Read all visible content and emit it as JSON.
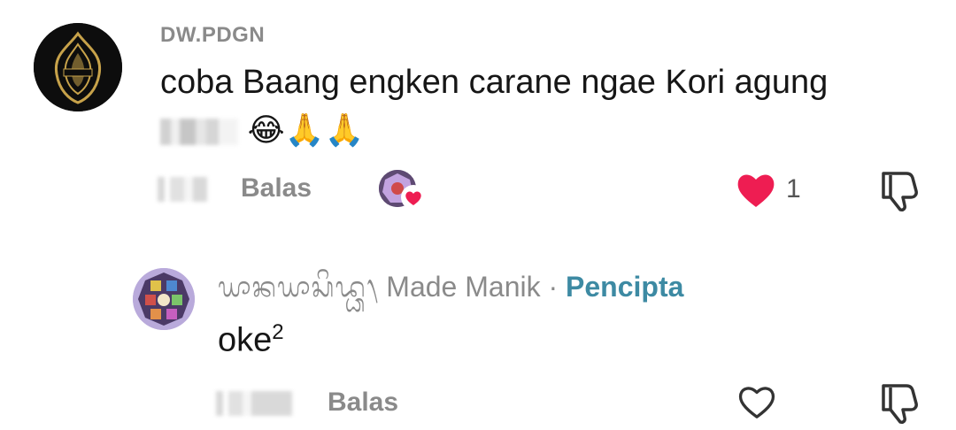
{
  "comment": {
    "username": "DW.PDGN",
    "text": "coba Baang engken carane ngae Kori agung",
    "emojis": "😂🙏🙏",
    "reply_label": "Balas",
    "like_count": "1",
    "liked": true
  },
  "reply": {
    "username_script": "ᬬᬵᬦᬬᬵᬲᬶᬤ᭄ᬥ᭞",
    "username": "Made Manik",
    "separator": "·",
    "creator_label": "Pencipta",
    "text": "oke",
    "superscript": "2",
    "reply_label": "Balas",
    "liked": false
  },
  "icons": {
    "like": "heart-icon",
    "dislike": "thumbs-down-icon",
    "creator_liked": "heart-badge-icon"
  },
  "colors": {
    "like_red": "#ee1d52",
    "creator_teal": "#3d8aa3",
    "meta_gray": "#8a8a8a"
  }
}
